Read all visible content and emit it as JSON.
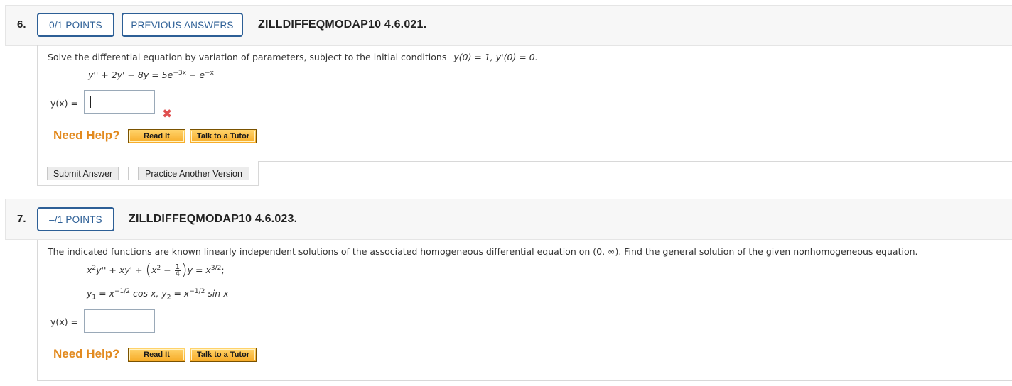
{
  "q6": {
    "number": "6.",
    "points": "0/1 POINTS",
    "previous_answers": "PREVIOUS ANSWERS",
    "id": "ZILLDIFFEQMODAP10 4.6.021.",
    "prompt": "Solve the differential equation by variation of parameters, subject to the initial conditions",
    "initial_conditions": "y(0) = 1, y'(0) = 0.",
    "equation": {
      "lhs": "y'' + 2y' − 8y = 5e",
      "exp1": "−3x",
      "mid": " − e",
      "exp2": "−x"
    },
    "answer_label": "y(x) =",
    "answer_value": "",
    "answer_status_icon": "x-mark-icon",
    "need_help": "Need Help?",
    "read_it": "Read It",
    "talk_to_tutor": "Talk to a Tutor",
    "submit_answer": "Submit Answer",
    "practice_another": "Practice Another Version"
  },
  "q7": {
    "number": "7.",
    "points": "–/1 POINTS",
    "id": "ZILLDIFFEQMODAP10 4.6.023.",
    "prompt": "The indicated functions are known linearly independent solutions of the associated homogeneous differential equation on (0, ∞). Find the general solution of the given nonhomogeneous equation.",
    "equation_parts": {
      "a": "x",
      "a_sup": "2",
      "b": "y'' + xy' + ",
      "c": "x",
      "c_sup": "2",
      "d": " − ",
      "frac_num": "1",
      "frac_den": "4",
      "e": "y = x",
      "e_sup": "3/2",
      "f": ";"
    },
    "solutions": {
      "y1": "y",
      "y1_sub": "1",
      "y1_rhs": " = x",
      "y1_sup": "−1/2",
      "y1_tail": " cos x, ",
      "y2": "y",
      "y2_sub": "2",
      "y2_rhs": " = x",
      "y2_sup": "−1/2",
      "y2_tail": " sin x"
    },
    "answer_label": "y(x) =",
    "answer_value": "",
    "need_help": "Need Help?",
    "read_it": "Read It",
    "talk_to_tutor": "Talk to a Tutor"
  },
  "colors": {
    "accent_blue": "#2d5f96",
    "need_help_orange": "#e28a1f",
    "error_red": "#e05050",
    "help_button_gold": "#f7ac28"
  }
}
